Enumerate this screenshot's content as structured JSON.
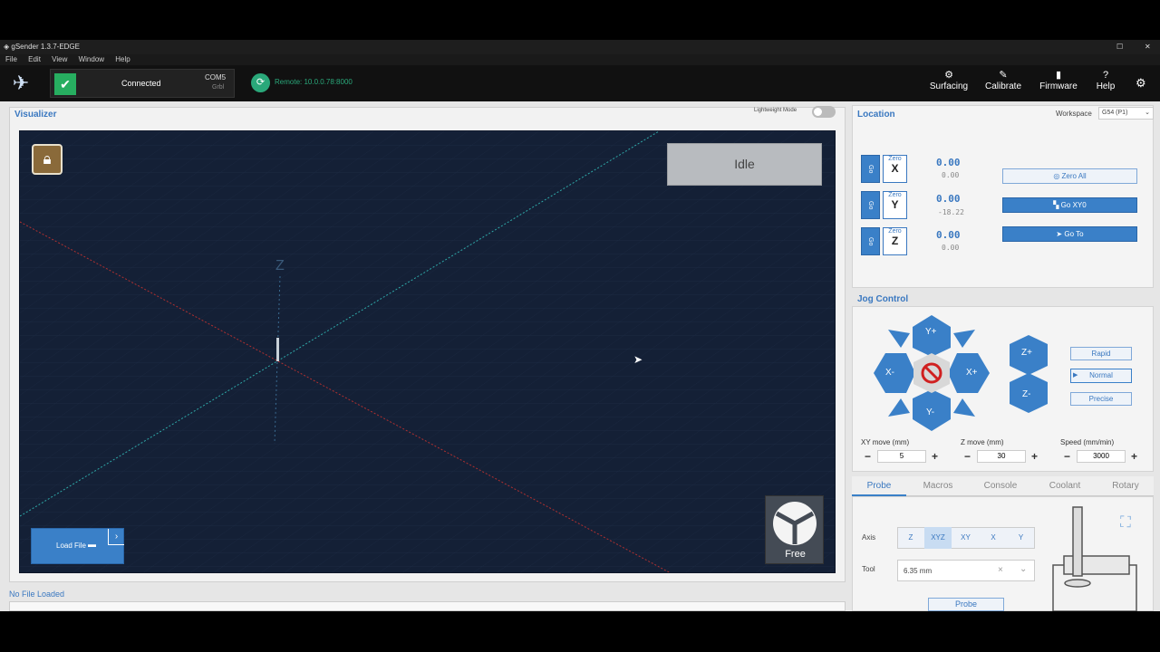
{
  "window": {
    "title": "gSender 1.3.7-EDGE",
    "menu": [
      "File",
      "Edit",
      "View",
      "Window",
      "Help"
    ]
  },
  "header": {
    "connection_status": "Connected",
    "port": "COM5",
    "controller": "Grbl",
    "remote": "Remote: 10.0.0.78:8000",
    "buttons": [
      {
        "label": "Surfacing",
        "icon": "surfacing-icon"
      },
      {
        "label": "Calibrate",
        "icon": "calibrate-icon"
      },
      {
        "label": "Firmware",
        "icon": "firmware-icon"
      },
      {
        "label": "Help",
        "icon": "help-icon"
      }
    ]
  },
  "visualizer": {
    "title": "Visualizer",
    "lightweight_label": "Lightweight Mode",
    "state": "Idle",
    "axis_label_z": "Z",
    "load_file": "Load File",
    "camera_mode": "Free",
    "file_status": "No File Loaded"
  },
  "location": {
    "title": "Location",
    "workspace_label": "Workspace",
    "workspace_value": "G54 (P1)",
    "go_label": "Go",
    "zero_label": "Zero",
    "axes": [
      {
        "axis": "X",
        "value": "0.00",
        "machine": "0.00"
      },
      {
        "axis": "Y",
        "value": "0.00",
        "machine": "-18.22"
      },
      {
        "axis": "Z",
        "value": "0.00",
        "machine": "0.00"
      }
    ],
    "zero_all": "Zero All",
    "go_xy0": "Go XY0",
    "go_to": "Go To"
  },
  "jog": {
    "title": "Jog Control",
    "labels": {
      "yplus": "Y+",
      "yminus": "Y-",
      "xplus": "X+",
      "xminus": "X-",
      "zplus": "Z+",
      "zminus": "Z-"
    },
    "speeds": [
      "Rapid",
      "Normal",
      "Precise"
    ],
    "xy_move_label": "XY move (mm)",
    "xy_move_value": "5",
    "z_move_label": "Z move (mm)",
    "z_move_value": "30",
    "speed_label": "Speed (mm/min)",
    "speed_value": "3000"
  },
  "tabs": [
    "Probe",
    "Macros",
    "Console",
    "Coolant",
    "Rotary"
  ],
  "probe": {
    "axis_label": "Axis",
    "axis_options": [
      "Z",
      "XYZ",
      "XY",
      "X",
      "Y"
    ],
    "selected_axis": "XYZ",
    "tool_label": "Tool",
    "tool_value": "6.35 mm",
    "probe_button": "Probe"
  },
  "colors": {
    "accent": "#3a80c8",
    "visualizer_bg": "#142036",
    "connected": "#27ae60"
  }
}
